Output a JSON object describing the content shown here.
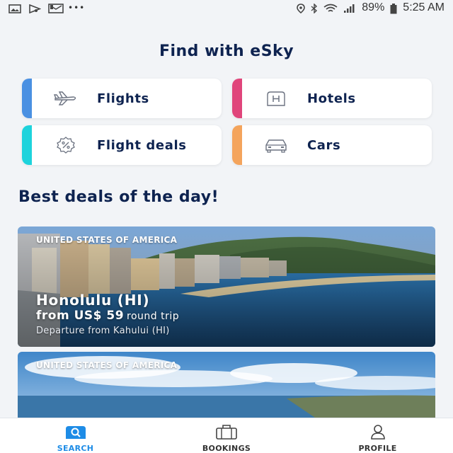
{
  "status_bar": {
    "battery": "89%",
    "time": "5:25 AM",
    "more": "•••"
  },
  "page": {
    "title": "Find with eSky"
  },
  "categories": [
    {
      "label": "Flights",
      "icon": "airplane-icon",
      "accent": "#4a90e2"
    },
    {
      "label": "Hotels",
      "icon": "hotel-icon",
      "accent": "#e0457b"
    },
    {
      "label": "Flight deals",
      "icon": "discount-badge-icon",
      "accent": "#1ed3dc"
    },
    {
      "label": "Cars",
      "icon": "car-icon",
      "accent": "#f4a45c"
    }
  ],
  "deals": {
    "title": "Best deals of the day!",
    "items": [
      {
        "country": "UNITED STATES OF AMERICA",
        "city": "Honolulu (HI)",
        "price": "from US$ 59",
        "trip": "round trip",
        "departure": "Departure from Kahului (HI)"
      },
      {
        "country": "UNITED STATES OF AMERICA"
      }
    ]
  },
  "bottom_nav": [
    {
      "label": "SEARCH",
      "icon": "search-icon",
      "active": true
    },
    {
      "label": "BOOKINGS",
      "icon": "briefcase-icon",
      "active": false
    },
    {
      "label": "PROFILE",
      "icon": "user-icon",
      "active": false
    }
  ],
  "colors": {
    "brand_navy": "#0e2350",
    "active_blue": "#1e8ce6",
    "background": "#f2f4f7"
  }
}
